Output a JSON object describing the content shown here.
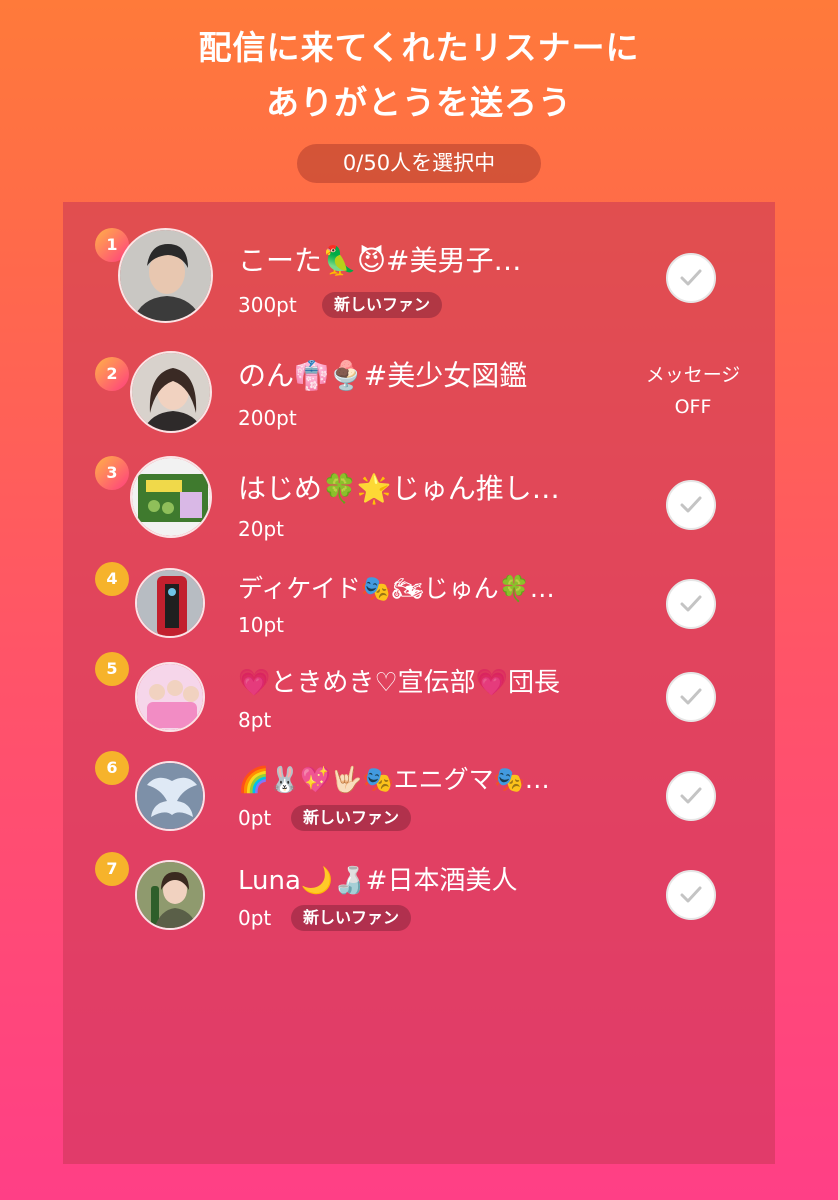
{
  "header": {
    "title_line1": "配信に来てくれたリスナーに",
    "title_line2": "ありがとうを送ろう",
    "selection_counter": "0/50人を選択中"
  },
  "listeners": [
    {
      "rank": "1",
      "name": "こーた🦜😈#美男子…",
      "points": "300pt",
      "badge": "新しいファン",
      "action": "check"
    },
    {
      "rank": "2",
      "name": "のん👘🍨#美少女図鑑",
      "points": "200pt",
      "badge": "",
      "action": "message_off"
    },
    {
      "rank": "3",
      "name": "はじめ🍀🌟じゅん推し…",
      "points": "20pt",
      "badge": "",
      "action": "check"
    },
    {
      "rank": "4",
      "name": "ディケイド🎭🏍じゅん🍀…",
      "points": "10pt",
      "badge": "",
      "action": "check"
    },
    {
      "rank": "5",
      "name": "💗ときめき♡宣伝部💗団長",
      "points": "8pt",
      "badge": "",
      "action": "check"
    },
    {
      "rank": "6",
      "name": "🌈🐰💖🤟🏻🎭エニグマ🎭…",
      "points": "0pt",
      "badge": "新しいファン",
      "action": "check"
    },
    {
      "rank": "7",
      "name": "Luna🌙🍶#日本酒美人",
      "points": "0pt",
      "badge": "新しいファン",
      "action": "check"
    }
  ],
  "message_off": {
    "line1": "メッセージ",
    "line2": "OFF"
  },
  "colors": {
    "background_top": "#ff7a3a",
    "background_bottom": "#ff3f86",
    "rank_gradient_start": "#ffb347",
    "rank_gradient_end": "#ff3d7f",
    "rank_yellow": "#f6b32b",
    "check_mark": "#c4c4c4"
  }
}
